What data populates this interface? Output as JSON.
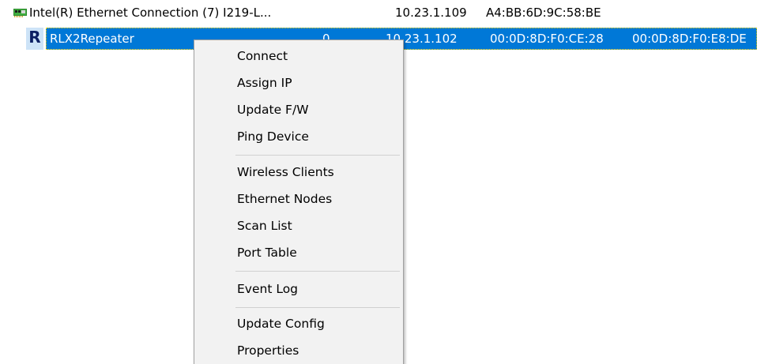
{
  "adapter": {
    "name": "Intel(R) Ethernet Connection (7) I219-L...",
    "ip": "10.23.1.109",
    "mac": "A4:BB:6D:9C:58:BE",
    "icon": "network-card-icon"
  },
  "device": {
    "icon_letter": "R",
    "name": "RLX2Repeater",
    "count": "0",
    "ip": "10.23.1.102",
    "mac1": "00:0D:8D:F0:CE:28",
    "mac2": "00:0D:8D:F0:E8:DE",
    "highlight_color": "#0078d7"
  },
  "context_menu": {
    "items": [
      "Connect",
      "Assign IP",
      "Update F/W",
      "Ping Device",
      "Wireless Clients",
      "Ethernet Nodes",
      "Scan List",
      "Port Table",
      "Event Log",
      "Update Config",
      "Properties"
    ]
  }
}
